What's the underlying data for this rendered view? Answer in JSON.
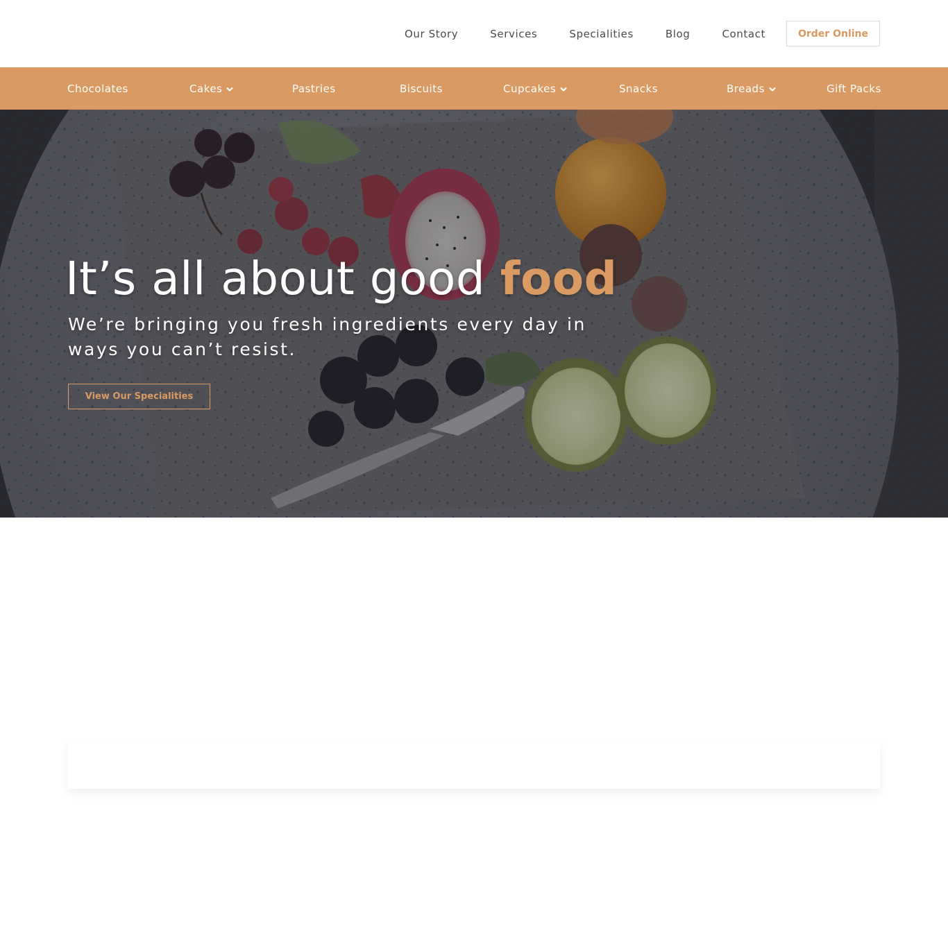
{
  "header": {
    "nav": [
      {
        "label": "Our Story"
      },
      {
        "label": "Services"
      },
      {
        "label": "Specialities"
      },
      {
        "label": "Blog"
      },
      {
        "label": "Contact"
      }
    ],
    "order_label": "Order Online"
  },
  "categories": [
    {
      "label": "Chocolates",
      "has_dropdown": false
    },
    {
      "label": "Cakes",
      "has_dropdown": true
    },
    {
      "label": "Pastries",
      "has_dropdown": false
    },
    {
      "label": "Biscuits",
      "has_dropdown": false
    },
    {
      "label": "Cupcakes",
      "has_dropdown": true
    },
    {
      "label": "Snacks",
      "has_dropdown": false
    },
    {
      "label": "Breads",
      "has_dropdown": true
    },
    {
      "label": "Gift Packs",
      "has_dropdown": false
    }
  ],
  "hero": {
    "title_main": "It’s all about good ",
    "title_accent": "food",
    "subtitle": "We’re bringing you fresh ingredients every day in ways you can’t resist.",
    "cta_label": "View Our Specialities"
  },
  "colors": {
    "accent": "#d99a63",
    "nav_text": "#4a4a4a",
    "hero_overlay": "#2c2d33"
  }
}
